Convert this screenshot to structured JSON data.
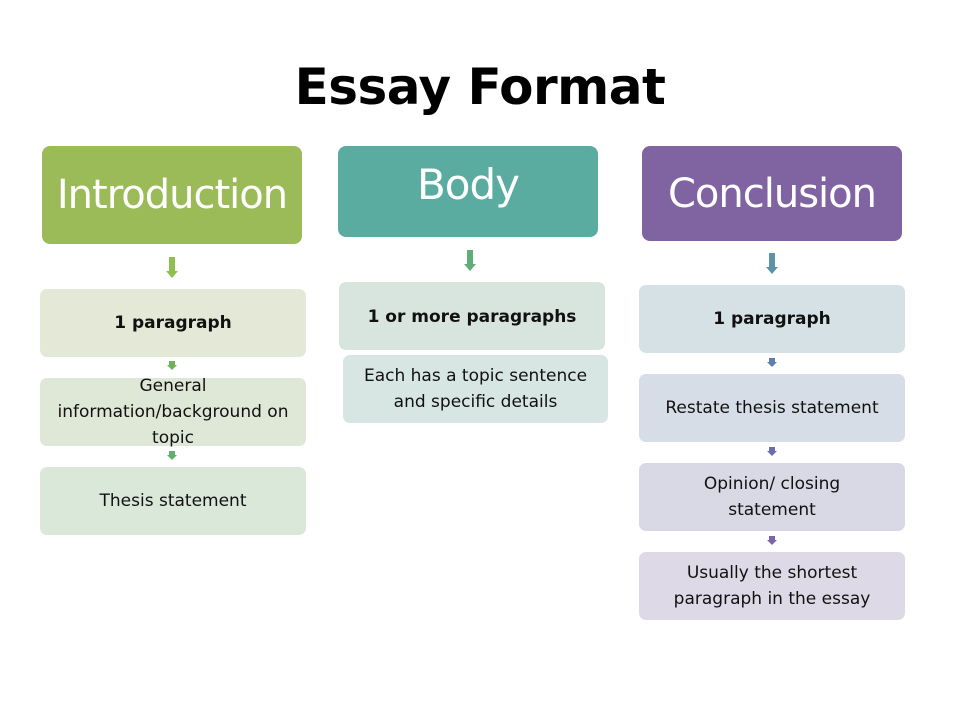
{
  "title": "Essay Format",
  "colors": {
    "introduction": "#9bbb59",
    "body": "#5aaba0",
    "conclusion": "#8064a2"
  },
  "columns": [
    {
      "heading": "Introduction",
      "items": [
        "1 paragraph",
        "General information/background on topic",
        "Thesis statement"
      ]
    },
    {
      "heading": "Body",
      "items": [
        "1 or more paragraphs",
        "Each has a topic sentence and specific details"
      ]
    },
    {
      "heading": "Conclusion",
      "items": [
        "1 paragraph",
        "Restate thesis statement",
        "Opinion/ closing statement",
        "Usually the shortest paragraph in the essay"
      ]
    }
  ]
}
